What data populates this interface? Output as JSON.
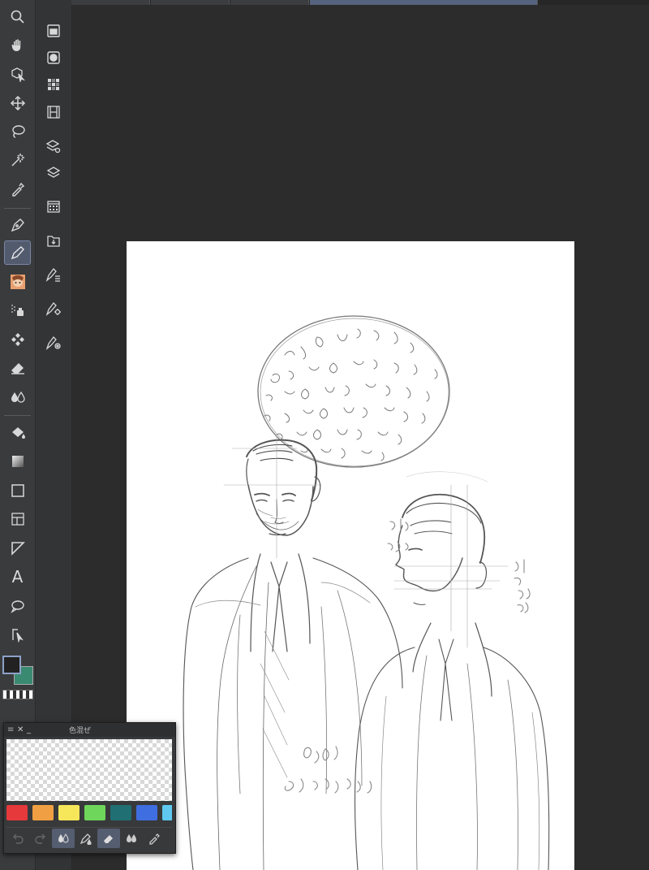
{
  "colors": {
    "main_color": "#222222",
    "sub_color": "#3a8a72",
    "accent": "#56637e"
  },
  "tools": [
    {
      "id": "zoom",
      "icon": "zoom-icon"
    },
    {
      "id": "hand",
      "icon": "hand-icon"
    },
    {
      "id": "operation",
      "icon": "object-select-icon"
    },
    {
      "id": "move-layer",
      "icon": "move-icon"
    },
    {
      "id": "lasso",
      "icon": "lasso-icon"
    },
    {
      "id": "magic-wand",
      "icon": "magic-wand-icon"
    },
    {
      "id": "eyedropper",
      "icon": "eyedropper-icon"
    },
    {
      "id": "pen",
      "icon": "pen-icon"
    },
    {
      "id": "pencil",
      "icon": "pencil-icon",
      "active": true
    },
    {
      "id": "brush",
      "icon": "brush-avatar-icon"
    },
    {
      "id": "airbrush",
      "icon": "airbrush-icon"
    },
    {
      "id": "decoration",
      "icon": "pattern-icon"
    },
    {
      "id": "eraser",
      "icon": "eraser-icon"
    },
    {
      "id": "blend",
      "icon": "blend-drops-icon"
    },
    {
      "id": "fill",
      "icon": "fill-bucket-icon"
    },
    {
      "id": "gradient",
      "icon": "gradient-icon"
    },
    {
      "id": "figure",
      "icon": "rectangle-icon"
    },
    {
      "id": "frame",
      "icon": "frame-border-icon"
    },
    {
      "id": "ruler",
      "icon": "ruler-icon"
    },
    {
      "id": "text",
      "icon": "text-icon",
      "glyph": "A"
    },
    {
      "id": "balloon",
      "icon": "balloon-icon"
    },
    {
      "id": "correct-line",
      "icon": "correct-line-icon"
    }
  ],
  "commands": [
    {
      "icon": "folder-icon"
    },
    {
      "icon": "circle-square-icon"
    },
    {
      "icon": "grid-dots-icon"
    },
    {
      "icon": "film-icon"
    },
    {
      "icon": "layers-settings-icon"
    },
    {
      "icon": "layers-icon"
    },
    {
      "icon": "calendar-grid-icon"
    },
    {
      "icon": "import-icon"
    },
    {
      "icon": "vector-list-icon"
    },
    {
      "icon": "vector-gear-icon"
    },
    {
      "icon": "vector-target-icon"
    }
  ],
  "color_mix_panel": {
    "title": "色混ぜ",
    "menu_icon": "≡",
    "close_icon": "✕",
    "minimize_icon": "_",
    "swatches": [
      "#e5393b",
      "#f0a042",
      "#f5e65a",
      "#6ed65a",
      "#1f6f73",
      "#3f6ee0",
      "#5ec8f0"
    ],
    "tools": [
      {
        "icon": "undo-icon",
        "enabled": false
      },
      {
        "icon": "redo-icon",
        "enabled": false
      },
      {
        "icon": "mix-drops-icon",
        "selected": true
      },
      {
        "icon": "pen-drop-icon"
      },
      {
        "icon": "eraser-small-icon",
        "selected": true
      },
      {
        "icon": "blend-small-icon"
      },
      {
        "icon": "eyedropper-small-icon"
      }
    ]
  }
}
